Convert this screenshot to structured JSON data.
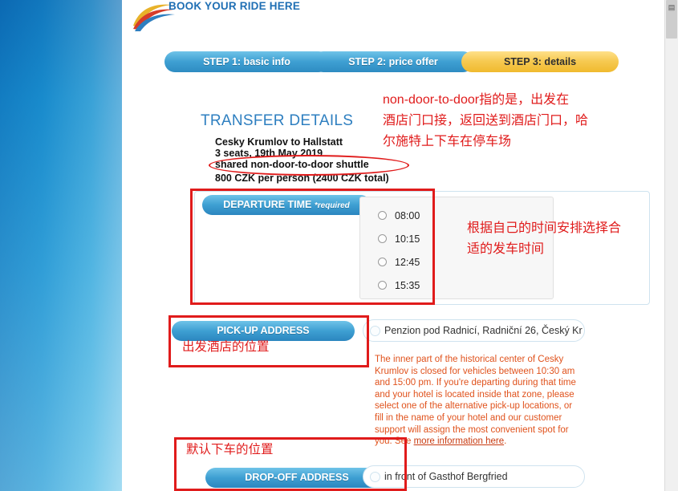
{
  "site": {
    "title": "BOOK YOUR RIDE HERE"
  },
  "steps": [
    {
      "label": "STEP 1: basic info",
      "state": "blue"
    },
    {
      "label": "STEP 2: price offer",
      "state": "blue"
    },
    {
      "label": "STEP 3: details",
      "state": "active-yellow"
    }
  ],
  "transfer": {
    "heading": "TRANSFER DETAILS",
    "route": "Cesky Krumlov to Hallstatt",
    "seats_date": "3 seats, 19th May 2019",
    "shuttle_type": "shared non-door-to-door shuttle",
    "price": "800 CZK per person (2400 CZK total)"
  },
  "departure": {
    "label": "DEPARTURE TIME",
    "required_note": "*required",
    "options": [
      "08:00",
      "10:15",
      "12:45",
      "15:35"
    ],
    "selected": ""
  },
  "pickup": {
    "label": "PICK-UP ADDRESS",
    "value": "Penzion pod Radnicí, Radniční 26, Český Kr",
    "notice_part1": "The inner part of the historical center of Cesky Krumlov is closed for vehicles between 10:30 am and 15:00 pm. If you're departing during that time and your hotel is located inside that zone, please select one of the alternative pick-up locations, or fill in the name of your hotel and our customer support will assign the most convenient spot for you. See ",
    "notice_link": "more information here",
    "notice_part2": "."
  },
  "dropoff": {
    "label": "DROP-OFF ADDRESS",
    "value": "in front of Gasthof Bergfried"
  },
  "annotations": {
    "top_note": "non-door-to-door指的是，出发在\n酒店门口接，返回送到酒店门口，哈\n尔施特上下车在停车场",
    "time_note": "根据自己的时间安排选择合\n适的发车时间",
    "pickup_note": "出发酒店的位置",
    "dropoff_note": "默认下车的位置"
  },
  "colors": {
    "annotation_red": "#e01b1b",
    "notice_orange": "#e0521c",
    "brand_blue": "#1f6fb4",
    "active_step_yellow": "#f6c951"
  },
  "scrollbar": {
    "icon": "scroll-thumb-icon"
  }
}
